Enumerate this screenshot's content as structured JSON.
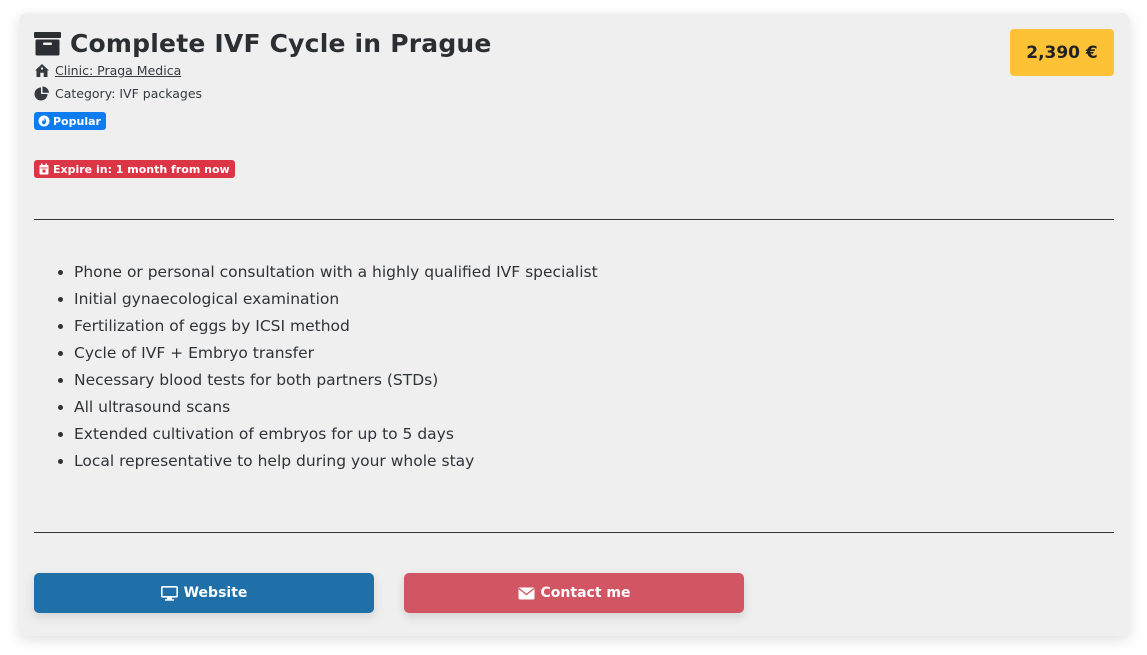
{
  "listing": {
    "title": "Complete IVF Cycle in Prague",
    "clinic_label": "Clinic: Praga Medica",
    "category_label": "Category: IVF packages",
    "popular_badge": "Popular",
    "expire_badge": "Expire in: 1 month from now",
    "price": "2,390 €"
  },
  "features": [
    "Phone or personal consultation with a highly qualified IVF specialist",
    "Initial gynaecological examination",
    "Fertilization of eggs by ICSI method",
    "Cycle of IVF + Embryo transfer",
    "Necessary blood tests for both partners (STDs)",
    "All ultrasound scans",
    "Extended cultivation of embryos for up to 5 days",
    "Local representative to help during your whole stay"
  ],
  "actions": {
    "website_label": "Website",
    "contact_label": "Contact me"
  },
  "icons": {
    "title": "archive-box-icon",
    "clinic": "home-icon",
    "category": "pie-chart-icon",
    "popular": "fire-icon",
    "expire": "calendar-icon",
    "website": "monitor-icon",
    "contact": "envelope-icon"
  },
  "colors": {
    "price_bg": "#fec236",
    "popular_badge": "#0d7cf0",
    "expire_badge": "#dc3545",
    "website_button": "#1f6fa8",
    "contact_button": "#d25563",
    "card_bg": "#efefef"
  }
}
